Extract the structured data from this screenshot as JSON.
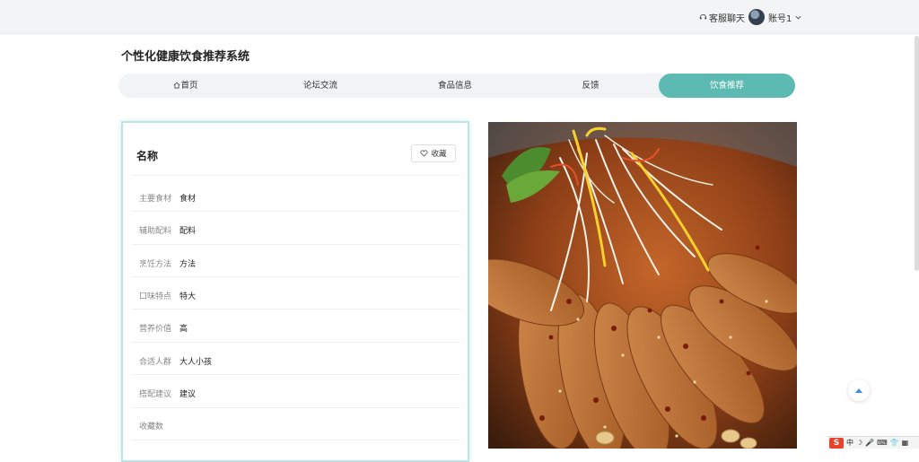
{
  "header": {
    "chat_label": "客服聊天",
    "account_label": "账号1"
  },
  "site": {
    "title": "个性化健康饮食推荐系统"
  },
  "nav": {
    "items": [
      {
        "label": "首页",
        "icon": "home-icon"
      },
      {
        "label": "论坛交流"
      },
      {
        "label": "食品信息"
      },
      {
        "label": "反馈"
      },
      {
        "label": "饮食推荐",
        "active": true
      }
    ]
  },
  "detail": {
    "title": "名称",
    "favorite_label": "收藏",
    "fields": [
      {
        "label": "主要食材",
        "value": "食材"
      },
      {
        "label": "辅助配料",
        "value": "配料"
      },
      {
        "label": "烹饪方法",
        "value": "方法"
      },
      {
        "label": "口味特点",
        "value": "特大"
      },
      {
        "label": "营养价值",
        "value": "高"
      },
      {
        "label": "合适人群",
        "value": "大人小孩"
      },
      {
        "label": "搭配建议",
        "value": "建议"
      },
      {
        "label": "收藏数",
        "value": ""
      }
    ]
  },
  "ime": {
    "mode": "中"
  },
  "colors": {
    "accent": "#5dbab2",
    "topbar": "#f3f4f5",
    "card_border": "#bfe3e0"
  }
}
